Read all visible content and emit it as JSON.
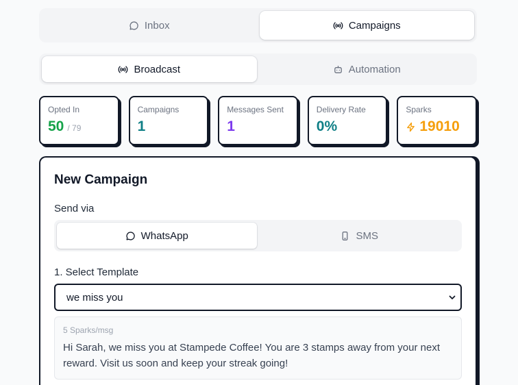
{
  "top_tabs": [
    {
      "label": "Inbox",
      "icon": "chat-bubble-icon",
      "active": false
    },
    {
      "label": "Campaigns",
      "icon": "broadcast-icon",
      "active": true
    }
  ],
  "sub_tabs": [
    {
      "label": "Broadcast",
      "icon": "broadcast-icon",
      "active": true
    },
    {
      "label": "Automation",
      "icon": "robot-icon",
      "active": false
    }
  ],
  "stats": {
    "opted_in": {
      "label": "Opted In",
      "value": "50",
      "sub": "/ 79"
    },
    "campaigns": {
      "label": "Campaigns",
      "value": "1"
    },
    "messages_sent": {
      "label": "Messages Sent",
      "value": "1"
    },
    "delivery_rate": {
      "label": "Delivery Rate",
      "value": "0%"
    },
    "sparks": {
      "label": "Sparks",
      "value": "19010",
      "icon": "lightning-icon"
    }
  },
  "campaign": {
    "title": "New Campaign",
    "send_via_label": "Send via",
    "channels": [
      {
        "label": "WhatsApp",
        "icon": "chat-bubble-icon",
        "active": true
      },
      {
        "label": "SMS",
        "icon": "phone-icon",
        "active": false
      }
    ],
    "template_label": "1. Select Template",
    "template_selected": "we miss you",
    "preview": {
      "cost": "5 Sparks/msg",
      "body": "Hi Sarah, we miss you at Stampede Coffee! You are 3 stamps away from your next reward. Visit us soon and keep your streak going!"
    }
  },
  "colors": {
    "green": "#16a34a",
    "teal": "#0f7f86",
    "purple": "#7c3aed",
    "orange": "#f59e0b",
    "border": "#111827"
  }
}
